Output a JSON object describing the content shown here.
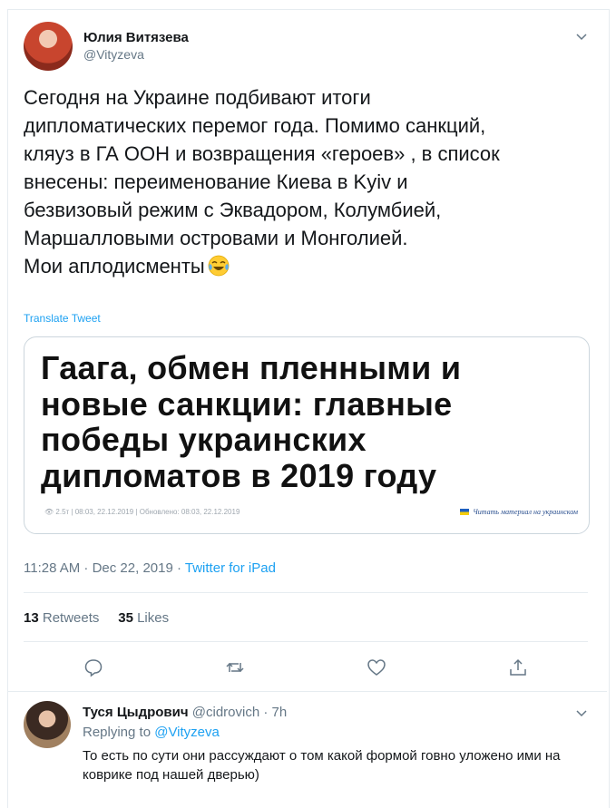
{
  "tweet": {
    "author_name": "Юлия Витязева",
    "author_handle": "@Vityzeva",
    "text": "Сегодня на Украине подбивают итоги\nдипломатических перемог года. Помимо санкций,\nкляуз в ГА ООН и возвращения «героев» , в список\nвнесены: переименование Киева в Kyiv и\nбезвизовый режим с Эквадором, Колумбией,\nМаршалловыми островами и Монголией.\nМои аплодисменты",
    "emoji": "face-with-tears-of-joy",
    "translate_label": "Translate Tweet",
    "card": {
      "headline": "Гаага, обмен пленными и новые санкции: главные победы украинских дипломатов в 2019 году",
      "meta": "2.5т  |  08:03, 22.12.2019  |  Обновлено: 08:03, 22.12.2019",
      "link_text": "Читать материал на украинском"
    },
    "timestamp": "11:28 AM · Dec 22, 2019 · ",
    "source": "Twitter for iPad",
    "retweets_count": "13",
    "retweets_label": "Retweets",
    "likes_count": "35",
    "likes_label": "Likes"
  },
  "reply": {
    "author_name": "Туся Цыдрович",
    "author_handle": "@cidrovich",
    "time": "7h",
    "replying_label": "Replying to",
    "replying_to": "@Vityzeva",
    "text": "То есть по сути они рассуждают о том какой формой говно уложено ими на коврике под нашей дверью)"
  },
  "colors": {
    "accent": "#1da1f2",
    "secondary_text": "#657786",
    "divider": "#e6ecf0"
  }
}
